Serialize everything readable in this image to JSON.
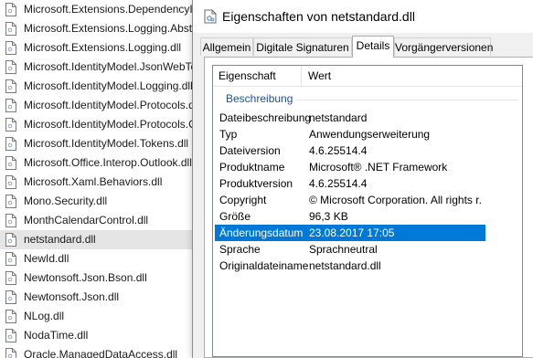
{
  "explorer": {
    "files": [
      {
        "name": "Microsoft.Extensions.DependencyInjection.dll",
        "selected": false
      },
      {
        "name": "Microsoft.Extensions.Logging.Abstractions.dll",
        "selected": false
      },
      {
        "name": "Microsoft.Extensions.Logging.dll",
        "selected": false
      },
      {
        "name": "Microsoft.IdentityModel.JsonWebTokens.dll",
        "selected": false
      },
      {
        "name": "Microsoft.IdentityModel.Logging.dll",
        "selected": false
      },
      {
        "name": "Microsoft.IdentityModel.Protocols.dll",
        "selected": false
      },
      {
        "name": "Microsoft.IdentityModel.Protocols.OpenIdConnect.dll",
        "selected": false
      },
      {
        "name": "Microsoft.IdentityModel.Tokens.dll",
        "selected": false
      },
      {
        "name": "Microsoft.Office.Interop.Outlook.dll",
        "selected": false
      },
      {
        "name": "Microsoft.Xaml.Behaviors.dll",
        "selected": false
      },
      {
        "name": "Mono.Security.dll",
        "selected": false
      },
      {
        "name": "MonthCalendarControl.dll",
        "selected": false
      },
      {
        "name": "netstandard.dll",
        "selected": true
      },
      {
        "name": "NewId.dll",
        "selected": false
      },
      {
        "name": "Newtonsoft.Json.Bson.dll",
        "selected": false
      },
      {
        "name": "Newtonsoft.Json.dll",
        "selected": false
      },
      {
        "name": "NLog.dll",
        "selected": false
      },
      {
        "name": "NodaTime.dll",
        "selected": false
      },
      {
        "name": "Oracle.ManagedDataAccess.dll",
        "selected": false
      }
    ],
    "file_icon": "document-icon"
  },
  "dialog": {
    "title": "Eigenschaften von netstandard.dll",
    "title_icon": "dll-file-icon",
    "tabs": [
      {
        "label": "Allgemein",
        "active": false
      },
      {
        "label": "Digitale Signaturen",
        "active": false
      },
      {
        "label": "Details",
        "active": true
      },
      {
        "label": "Vorgängerversionen",
        "active": false
      }
    ],
    "details": {
      "col_property": "Eigenschaft",
      "col_value": "Wert",
      "group": "Beschreibung",
      "rows": [
        {
          "name": "Dateibeschreibung",
          "value": "netstandard",
          "selected": false
        },
        {
          "name": "Typ",
          "value": "Anwendungserweiterung",
          "selected": false
        },
        {
          "name": "Dateiversion",
          "value": "4.6.25514.4",
          "selected": false
        },
        {
          "name": "Produktname",
          "value": "Microsoft® .NET Framework",
          "selected": false
        },
        {
          "name": "Produktversion",
          "value": "4.6.25514.4",
          "selected": false
        },
        {
          "name": "Copyright",
          "value": "© Microsoft Corporation.  All rights r...",
          "selected": false
        },
        {
          "name": "Größe",
          "value": "96,3 KB",
          "selected": false
        },
        {
          "name": "Änderungsdatum",
          "value": "23.08.2017 17:05",
          "selected": true
        },
        {
          "name": "Sprache",
          "value": "Sprachneutral",
          "selected": false
        },
        {
          "name": "Originaldateiname",
          "value": "netstandard.dll",
          "selected": false
        }
      ]
    }
  },
  "colors": {
    "selection": "#0078d7",
    "group_heading": "#1e4e9a",
    "explorer_selection": "#e5e5e5"
  }
}
